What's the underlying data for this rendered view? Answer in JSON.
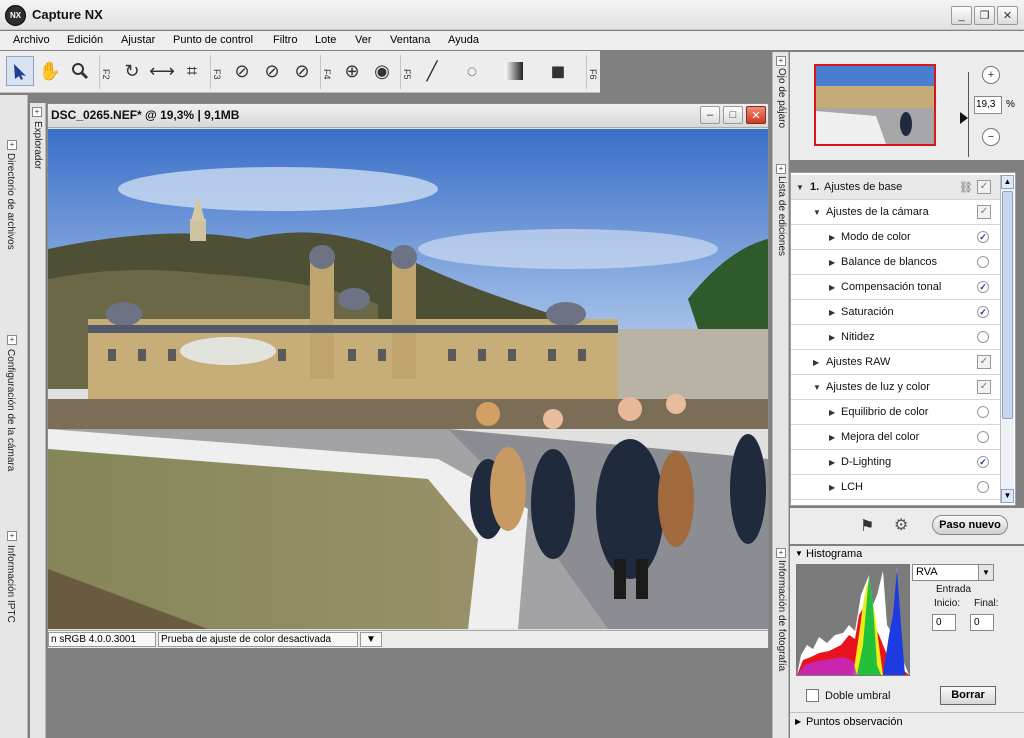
{
  "window": {
    "title": "Capture NX",
    "logo_text": "NX",
    "minimize": "_",
    "maximize": "❐",
    "close": "✕"
  },
  "menu": [
    "Archivo",
    "Edición",
    "Ajustar",
    "Punto de control",
    "Filtro",
    "Lote",
    "Ver",
    "Ventana",
    "Ayuda"
  ],
  "toolbar": {
    "groups": [
      "F2",
      "F3",
      "F4",
      "F5",
      "F6"
    ],
    "tools": [
      "direct-select",
      "hand",
      "zoom",
      "rotate",
      "straighten",
      "crop",
      "black-point",
      "neutral-point",
      "white-point",
      "red-eye",
      "selection",
      "brush",
      "lasso",
      "gradient",
      "fill"
    ]
  },
  "left_panels": [
    "Directorio de archivos",
    "Configuración de la cámara",
    "Información IPTC"
  ],
  "explorer_label": "Explorador",
  "document": {
    "title": "DSC_0265.NEF* @ 19,3% | 9,1MB",
    "status_profile": "n sRGB 4.0.0.3001",
    "status_proof": "Prueba de ajuste de color desactivada"
  },
  "right_tabs": [
    "Ojo de pájaro",
    "Lista de ediciones",
    "Información de fotografía"
  ],
  "birdseye": {
    "zoom_value": "19,3",
    "zoom_unit": "%"
  },
  "edit_list": {
    "rows": [
      {
        "label": "Ajustes de base",
        "number": "1.",
        "level": 0
      },
      {
        "label": "Ajustes de la cámara",
        "level": 1
      },
      {
        "label": "Modo de color",
        "level": 2,
        "checked": true
      },
      {
        "label": "Balance de blancos",
        "level": 2,
        "checked": false
      },
      {
        "label": "Compensación tonal",
        "level": 2,
        "checked": true
      },
      {
        "label": "Saturación",
        "level": 2,
        "checked": true
      },
      {
        "label": "Nitidez",
        "level": 2,
        "checked": false
      },
      {
        "label": "Ajustes RAW",
        "level": 1
      },
      {
        "label": "Ajustes de luz y color",
        "level": 1
      },
      {
        "label": "Equilibrio de color",
        "level": 2,
        "checked": false
      },
      {
        "label": "Mejora del color",
        "level": 2,
        "checked": false
      },
      {
        "label": "D-Lighting",
        "level": 2,
        "checked": true
      },
      {
        "label": "LCH",
        "level": 2,
        "checked": false
      }
    ],
    "new_step_button": "Paso nuevo"
  },
  "histogram": {
    "title": "Histograma",
    "channel": "RVA",
    "entrada_label": "Entrada",
    "inicio_label": "Inicio:",
    "final_label": "Final:",
    "inicio_value": "0",
    "final_value": "0",
    "doble_umbral": "Doble umbral",
    "borrar_button": "Borrar"
  },
  "puntos_panel": "Puntos observación",
  "colors": {
    "accent_red": "#d8181d",
    "check_blue": "#1c3f94",
    "panel_bg": "#ececec"
  }
}
